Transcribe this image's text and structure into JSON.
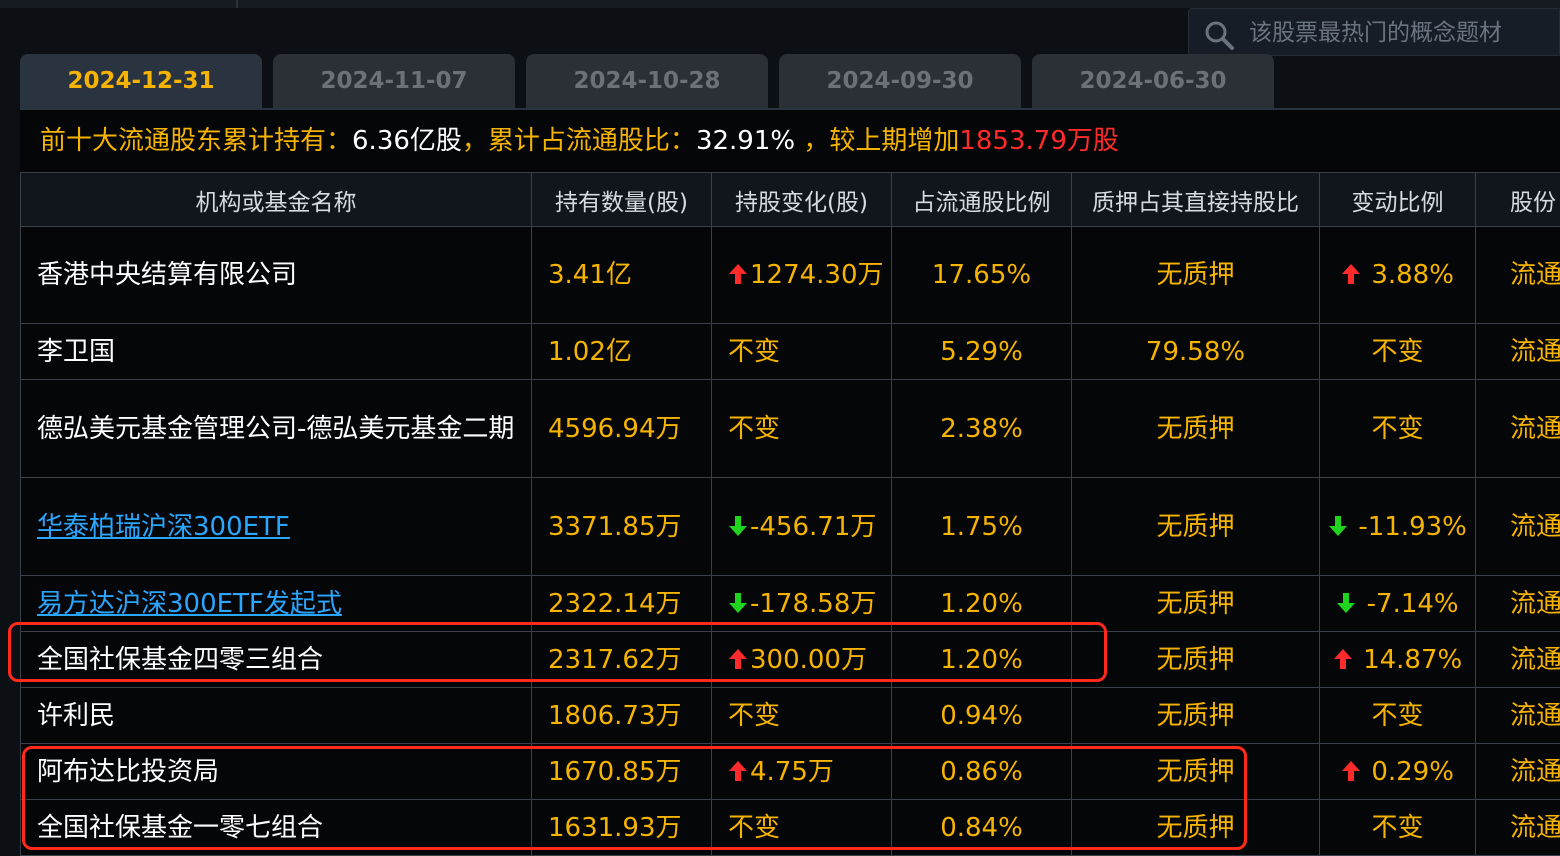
{
  "search": {
    "placeholder": "该股票最热门的概念题材"
  },
  "tabs": [
    {
      "label": "2024-12-31",
      "active": true
    },
    {
      "label": "2024-11-07",
      "active": false
    },
    {
      "label": "2024-10-28",
      "active": false
    },
    {
      "label": "2024-09-30",
      "active": false
    },
    {
      "label": "2024-06-30",
      "active": false
    }
  ],
  "summary": {
    "prefix": "前十大流通股东累计持有：",
    "holdings": "6.36亿股",
    "ratio_label": "，累计占流通股比：",
    "ratio": "32.91%",
    "change_label": " ，较上期增加",
    "change": "1853.79万股"
  },
  "table": {
    "headers": [
      "机构或基金名称",
      "持有数量(股)",
      "持股变化(股)",
      "占流通股比例",
      "质押占其直接持股比",
      "变动比例",
      "股份"
    ],
    "rows": [
      {
        "name": "香港中央结算有限公司",
        "link": false,
        "qty": "3.41亿",
        "change": "1274.30万",
        "change_dir": "up",
        "ratio": "17.65%",
        "pledge": "无质押",
        "var": "3.88%",
        "var_dir": "up",
        "type": "流通"
      },
      {
        "name": "李卫国",
        "link": false,
        "qty": "1.02亿",
        "change": "不变",
        "change_dir": "none",
        "ratio": "5.29%",
        "pledge": "79.58%",
        "var": "不变",
        "var_dir": "none",
        "type": "流通"
      },
      {
        "name": "德弘美元基金管理公司-德弘美元基金二期",
        "link": false,
        "qty": "4596.94万",
        "change": "不变",
        "change_dir": "none",
        "ratio": "2.38%",
        "pledge": "无质押",
        "var": "不变",
        "var_dir": "none",
        "type": "流通"
      },
      {
        "name": "华泰柏瑞沪深300ETF",
        "link": true,
        "qty": "3371.85万",
        "change": "-456.71万",
        "change_dir": "down",
        "ratio": "1.75%",
        "pledge": "无质押",
        "var": "-11.93%",
        "var_dir": "down",
        "type": "流通"
      },
      {
        "name": "易方达沪深300ETF发起式",
        "link": true,
        "qty": "2322.14万",
        "change": "-178.58万",
        "change_dir": "down",
        "ratio": "1.20%",
        "pledge": "无质押",
        "var": "-7.14%",
        "var_dir": "down",
        "type": "流通"
      },
      {
        "name": "全国社保基金四零三组合",
        "link": false,
        "qty": "2317.62万",
        "change": "300.00万",
        "change_dir": "up",
        "ratio": "1.20%",
        "pledge": "无质押",
        "var": "14.87%",
        "var_dir": "up",
        "type": "流通"
      },
      {
        "name": "许利民",
        "link": false,
        "qty": "1806.73万",
        "change": "不变",
        "change_dir": "none",
        "ratio": "0.94%",
        "pledge": "无质押",
        "var": "不变",
        "var_dir": "none",
        "type": "流通"
      },
      {
        "name": "阿布达比投资局",
        "link": false,
        "qty": "1670.85万",
        "change": "4.75万",
        "change_dir": "up",
        "ratio": "0.86%",
        "pledge": "无质押",
        "var": "0.29%",
        "var_dir": "up",
        "type": "流通"
      },
      {
        "name": "全国社保基金一零七组合",
        "link": false,
        "qty": "1631.93万",
        "change": "不变",
        "change_dir": "none",
        "ratio": "0.84%",
        "pledge": "无质押",
        "var": "不变",
        "var_dir": "none",
        "type": "流通"
      }
    ]
  },
  "colors": {
    "accent": "#f6b400",
    "up": "#ff2a2a",
    "down": "#1fd31f",
    "link": "#2aa6ff",
    "highlight": "#ff2a1a"
  }
}
